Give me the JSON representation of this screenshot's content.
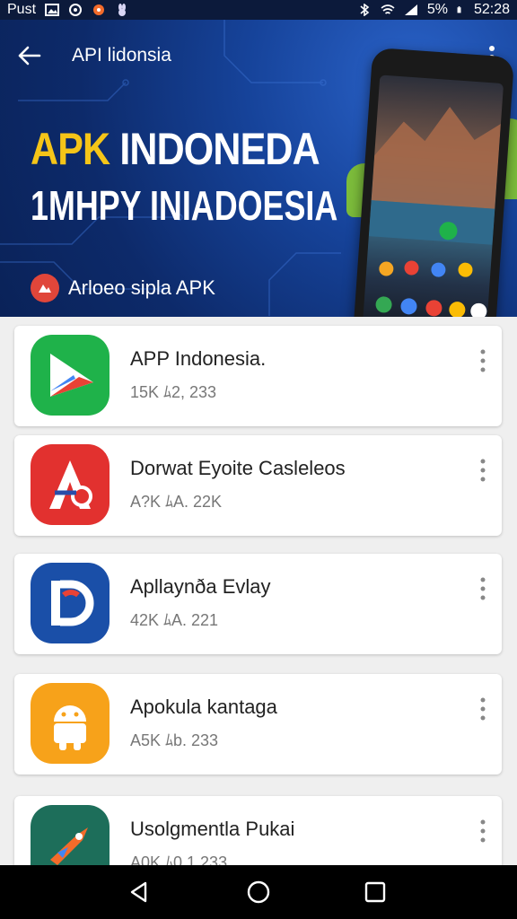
{
  "status_bar": {
    "carrier": "Pust",
    "battery": "5%",
    "time": "52:28"
  },
  "header": {
    "title": "API lidonsia",
    "headline_yellow": "APK",
    "headline_white": "INDONEDA",
    "headline_line2": "1MHPY INIADOESIA",
    "subline": "Arloeo sipla APK"
  },
  "apps": [
    {
      "name": "APP Indonesia.",
      "meta": "15K  ﾑ2, 233",
      "icon": "play-store-icon",
      "color": "#1fb24a"
    },
    {
      "name": "Dorwat Eyoite Casleleos",
      "meta": "A?K  ﾑA. 22K",
      "icon": "a-logo-icon",
      "color": "#e2312f"
    },
    {
      "name": "Apllaynða Evlay",
      "meta": "42K  ﾑA. 221",
      "icon": "d-logo-icon",
      "color": "#1a4fa8"
    },
    {
      "name": "Apokula kantaga",
      "meta": "A5K  ﾑb. 233",
      "icon": "android-icon",
      "color": "#f7a21a"
    },
    {
      "name": "Usolgmentla Pukai",
      "meta": "A0K  ﾑ0 1 233",
      "icon": "rocket-icon",
      "color": "#1d6e5a"
    }
  ],
  "colors": {
    "hero_bg": "#16439a",
    "accent_yellow": "#f5c518",
    "statusbar_bg": "#0c1a3b"
  }
}
